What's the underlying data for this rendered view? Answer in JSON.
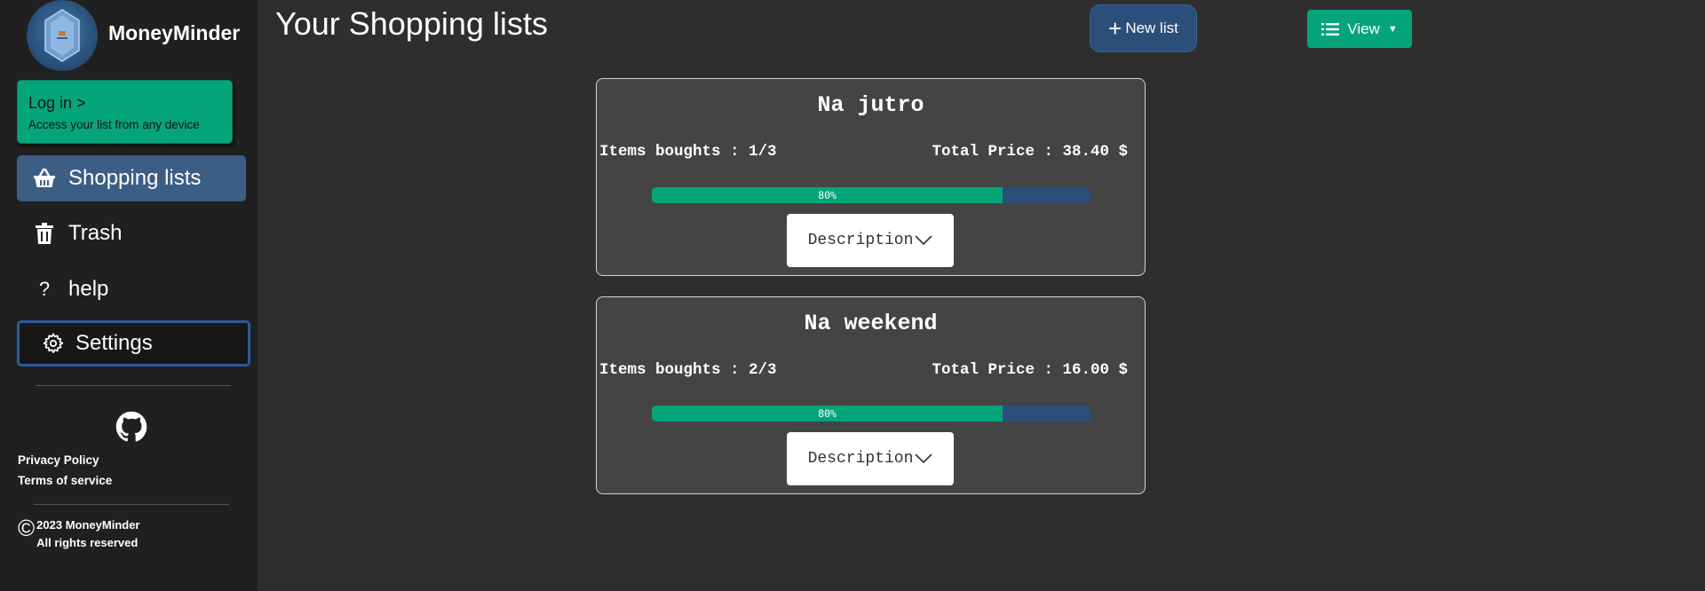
{
  "app": {
    "name": "MoneyMinder"
  },
  "login": {
    "title": "Log in >",
    "subtitle": "Access your list from any device"
  },
  "sidebar": {
    "items": [
      {
        "label": "Shopping lists",
        "icon": "basket-icon"
      },
      {
        "label": "Trash",
        "icon": "trash-icon"
      },
      {
        "label": "help",
        "icon": "question-icon"
      },
      {
        "label": "Settings",
        "icon": "gear-icon"
      }
    ]
  },
  "footer": {
    "privacy": "Privacy Policy",
    "terms": "Terms of service",
    "copyright_line1": "2023 MoneyMinder",
    "copyright_line2": "All rights reserved"
  },
  "header": {
    "title": "Your Shopping lists",
    "new_list_label": "New list",
    "view_label": "View"
  },
  "lists": [
    {
      "name": "Na jutro",
      "items_text": "Items boughts : 1/3",
      "price_text": "Total Price : 38.40 $",
      "progress_label": "80%",
      "progress": 0.8,
      "description_label": "Description"
    },
    {
      "name": "Na weekend",
      "items_text": "Items boughts : 2/3",
      "price_text": "Total Price : 16.00 $",
      "progress_label": "80%",
      "progress": 0.8,
      "description_label": "Description"
    }
  ],
  "colors": {
    "accent_green": "#05a57a",
    "accent_blue": "#2b4f7b",
    "sidebar_bg": "#202020",
    "main_bg": "#2e2e2e",
    "card_bg": "#444444"
  }
}
